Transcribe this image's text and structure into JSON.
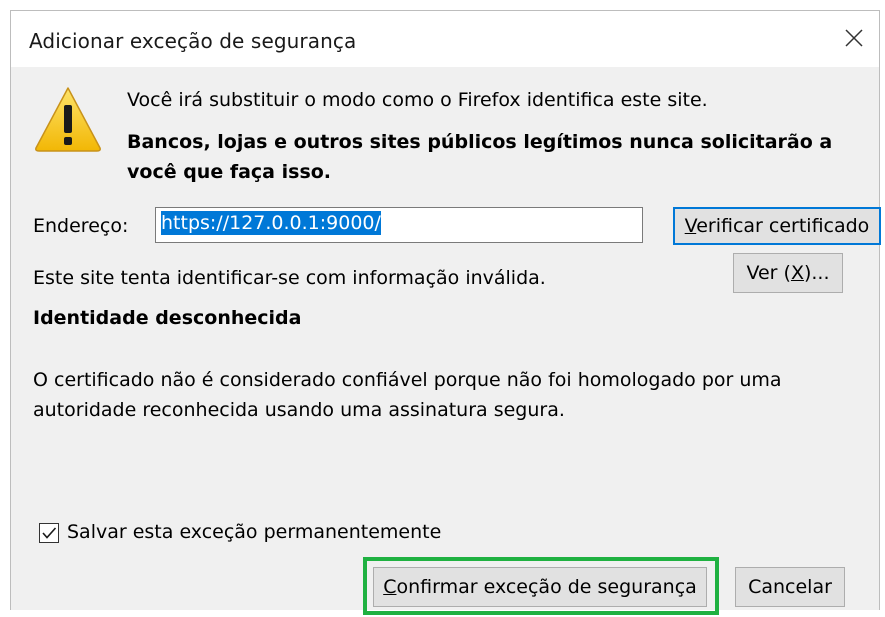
{
  "dialog": {
    "title": "Adicionar exceção de segurança",
    "close_icon": "close-icon",
    "intro": "Você irá substituir o modo como o Firefox identifica este site.",
    "warning": "Bancos, lojas e outros sites públicos legítimos nunca solicitarão a você que faça isso.",
    "warning_icon": "warning-triangle-icon",
    "address_label": "Endereço:",
    "address_value": "https://127.0.0.1:9000/",
    "verify_button_prefix": "",
    "verify_button_accel": "V",
    "verify_button_rest": "erificar certificado",
    "info_line": "Este site tenta identificar-se com informação inválida.",
    "view_button_prefix": "Ver (",
    "view_button_accel": "X",
    "view_button_suffix": ")...",
    "identity_title": "Identidade desconhecida",
    "identity_description": "O certificado não é considerado confiável porque não foi homologado por uma autoridade reconhecida usando uma assinatura segura.",
    "checkbox_label": "Salvar esta exceção permanentemente",
    "checkbox_checked": true,
    "confirm_button_accel": "C",
    "confirm_button_rest": "onfirmar exceção de segurança",
    "cancel_button": "Cancelar"
  },
  "colors": {
    "accent": "#0078d7",
    "highlight": "#1fb141",
    "warning_yellow": "#f7c81c"
  }
}
